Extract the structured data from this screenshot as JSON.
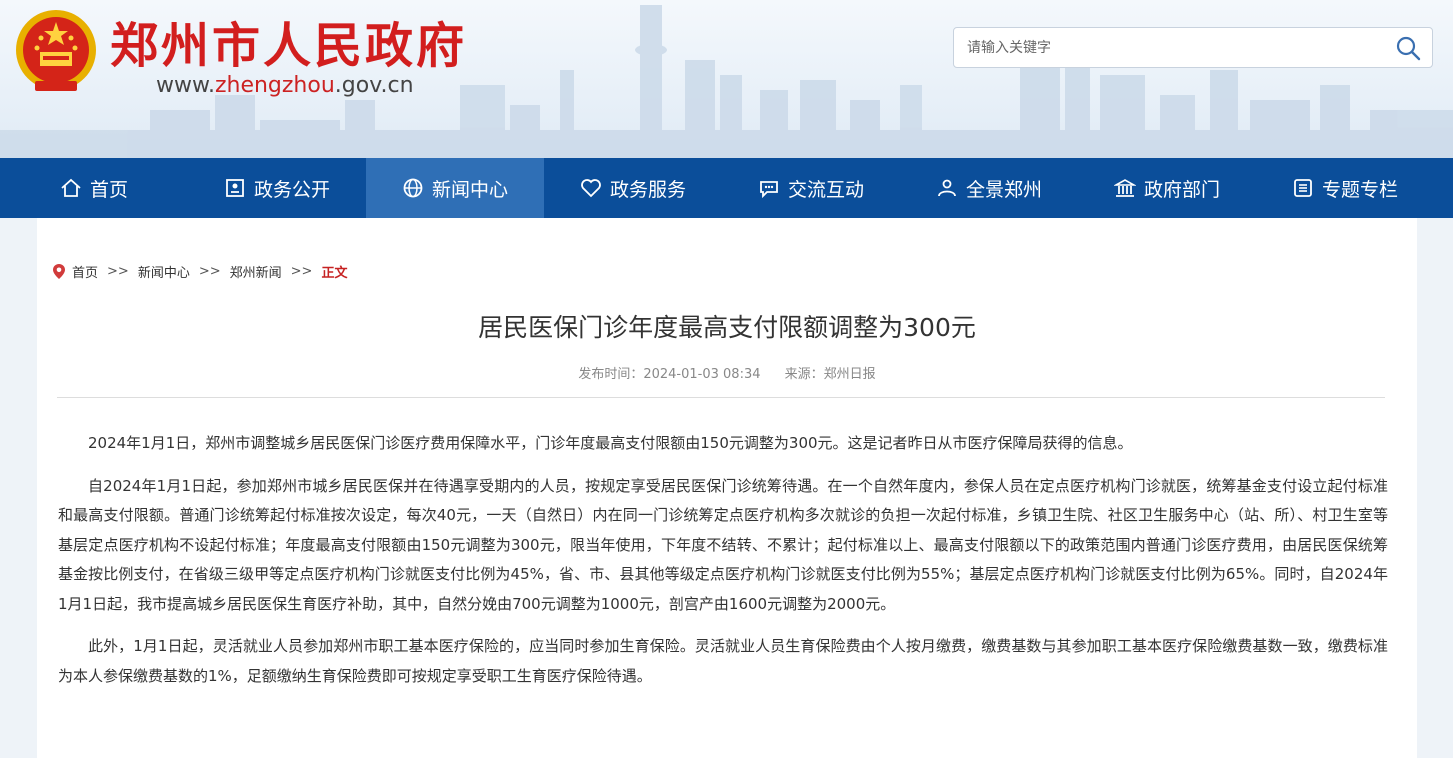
{
  "header": {
    "site_title": "郑州市人民政府",
    "url_prefix": "www.",
    "url_highlight": "zhengzhou",
    "url_suffix": ".gov.cn",
    "search_placeholder": "请输入关键字"
  },
  "nav": {
    "items": [
      {
        "label": "首页",
        "icon": "home-icon"
      },
      {
        "label": "政务公开",
        "icon": "document-icon"
      },
      {
        "label": "新闻中心",
        "icon": "globe-icon"
      },
      {
        "label": "政务服务",
        "icon": "heart-icon"
      },
      {
        "label": "交流互动",
        "icon": "chat-icon"
      },
      {
        "label": "全景郑州",
        "icon": "people-icon"
      },
      {
        "label": "政府部门",
        "icon": "building-icon"
      },
      {
        "label": "专题专栏",
        "icon": "list-icon"
      }
    ],
    "active_index": 2
  },
  "breadcrumb": {
    "items": [
      "首页",
      "新闻中心",
      "郑州新闻"
    ],
    "separator": ">>",
    "current": "正文"
  },
  "article": {
    "title": "居民医保门诊年度最高支付限额调整为300元",
    "publish_label": "发布时间：2024-01-03 08:34",
    "source_label": "来源：郑州日报",
    "paragraphs": [
      "2024年1月1日，郑州市调整城乡居民医保门诊医疗费用保障水平，门诊年度最高支付限额由150元调整为300元。这是记者昨日从市医疗保障局获得的信息。",
      "自2024年1月1日起，参加郑州市城乡居民医保并在待遇享受期内的人员，按规定享受居民医保门诊统筹待遇。在一个自然年度内，参保人员在定点医疗机构门诊就医，统筹基金支付设立起付标准和最高支付限额。普通门诊统筹起付标准按次设定，每次40元，一天（自然日）内在同一门诊统筹定点医疗机构多次就诊的负担一次起付标准，乡镇卫生院、社区卫生服务中心（站、所）、村卫生室等基层定点医疗机构不设起付标准；年度最高支付限额由150元调整为300元，限当年使用，下年度不结转、不累计；起付标准以上、最高支付限额以下的政策范围内普通门诊医疗费用，由居民医保统筹基金按比例支付，在省级三级甲等定点医疗机构门诊就医支付比例为45%，省、市、县其他等级定点医疗机构门诊就医支付比例为55%；基层定点医疗机构门诊就医支付比例为65%。同时，自2024年1月1日起，我市提高城乡居民医保生育医疗补助，其中，自然分娩由700元调整为1000元，剖宫产由1600元调整为2000元。",
      "此外，1月1日起，灵活就业人员参加郑州市职工基本医疗保险的，应当同时参加生育保险。灵活就业人员生育保险费由个人按月缴费，缴费基数与其参加职工基本医疗保险缴费基数一致，缴费标准为本人参保缴费基数的1%，足额缴纳生育保险费即可按规定享受职工生育医疗保险待遇。"
    ]
  },
  "colors": {
    "brand_red": "#d21e1e",
    "nav_blue": "#0b4e9a",
    "nav_active": "#2f6fb6",
    "breadcrumb_current": "#c62222"
  }
}
